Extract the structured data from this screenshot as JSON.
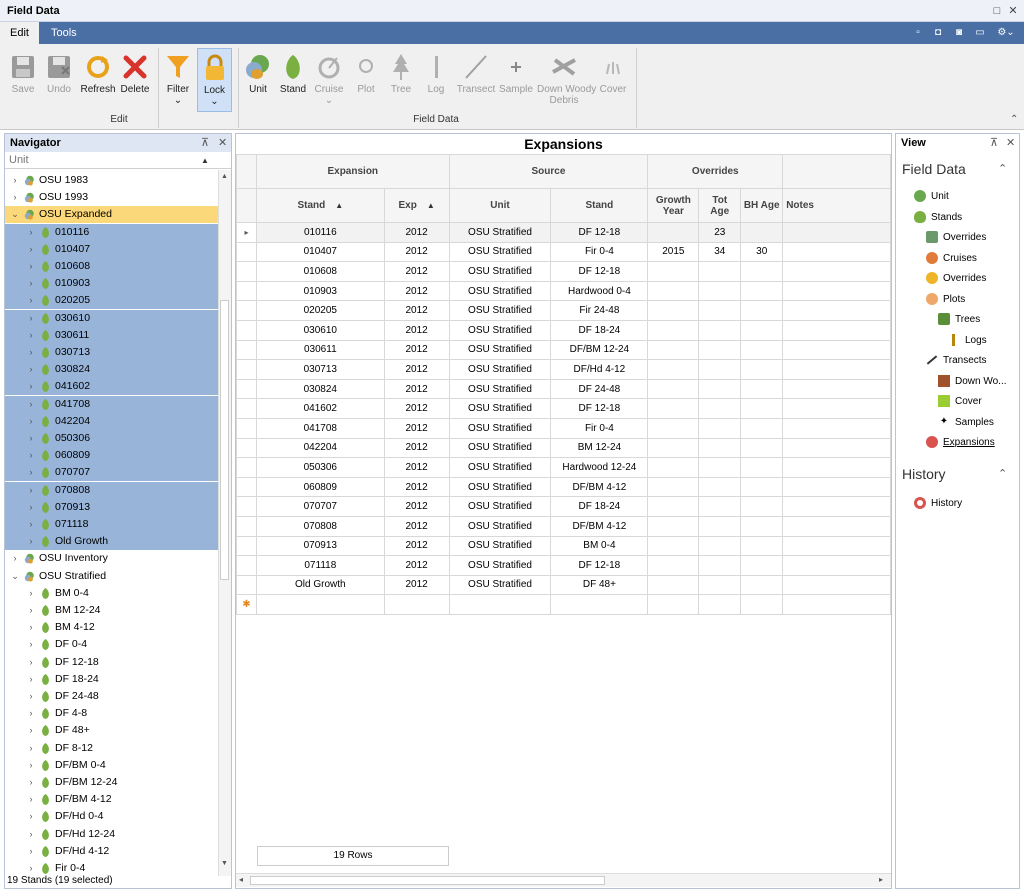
{
  "app": {
    "title": "Field Data"
  },
  "tabs": [
    "Edit",
    "Tools"
  ],
  "ribbon": {
    "edit_group": "Edit",
    "field_group": "Field Data",
    "buttons": {
      "save": "Save",
      "undo": "Undo",
      "refresh": "Refresh",
      "delete": "Delete",
      "filter": "Filter",
      "lock": "Lock",
      "unit": "Unit",
      "stand": "Stand",
      "cruise": "Cruise",
      "plot": "Plot",
      "tree": "Tree",
      "log": "Log",
      "transect": "Transect",
      "sample": "Sample",
      "down_woody_1": "Down Woody",
      "down_woody_2": "Debris",
      "cover": "Cover"
    }
  },
  "navigator": {
    "title": "Navigator",
    "column": "Unit",
    "units": [
      "OSU 1983",
      "OSU 1993",
      "OSU Expanded",
      "OSU Inventory",
      "OSU Stratified"
    ],
    "expanded_stands": [
      "010116",
      "010407",
      "010608",
      "010903",
      "020205",
      "030610",
      "030611",
      "030713",
      "030824",
      "041602",
      "041708",
      "042204",
      "050306",
      "060809",
      "070707",
      "070808",
      "070913",
      "071118",
      "Old Growth"
    ],
    "stratified_stands": [
      "BM 0-4",
      "BM 12-24",
      "BM 4-12",
      "DF 0-4",
      "DF 12-18",
      "DF 18-24",
      "DF 24-48",
      "DF 4-8",
      "DF 48+",
      "DF 8-12",
      "DF/BM 0-4",
      "DF/BM 12-24",
      "DF/BM 4-12",
      "DF/Hd 0-4",
      "DF/Hd 12-24",
      "DF/Hd 4-12",
      "Fir 0-4"
    ],
    "status": "19 Stands (19 selected)"
  },
  "grid": {
    "title": "Expansions",
    "bands": {
      "expansion": "Expansion",
      "source": "Source",
      "overrides": "Overrides"
    },
    "columns": {
      "stand": "Stand",
      "exp": "Exp",
      "unit": "Unit",
      "src_stand": "Stand",
      "growth_year_1": "Growth",
      "growth_year_2": "Year",
      "tot_age_1": "Tot",
      "tot_age_2": "Age",
      "bh_age": "BH Age",
      "notes": "Notes"
    },
    "rows": [
      [
        "010116",
        "2012",
        "OSU Stratified",
        "DF 12-18",
        "",
        "23",
        ""
      ],
      [
        "010407",
        "2012",
        "OSU Stratified",
        "Fir 0-4",
        "2015",
        "34",
        "30"
      ],
      [
        "010608",
        "2012",
        "OSU Stratified",
        "DF 12-18",
        "",
        "",
        ""
      ],
      [
        "010903",
        "2012",
        "OSU Stratified",
        "Hardwood 0-4",
        "",
        "",
        ""
      ],
      [
        "020205",
        "2012",
        "OSU Stratified",
        "Fir 24-48",
        "",
        "",
        ""
      ],
      [
        "030610",
        "2012",
        "OSU Stratified",
        "DF 18-24",
        "",
        "",
        ""
      ],
      [
        "030611",
        "2012",
        "OSU Stratified",
        "DF/BM 12-24",
        "",
        "",
        ""
      ],
      [
        "030713",
        "2012",
        "OSU Stratified",
        "DF/Hd 4-12",
        "",
        "",
        ""
      ],
      [
        "030824",
        "2012",
        "OSU Stratified",
        "DF 24-48",
        "",
        "",
        ""
      ],
      [
        "041602",
        "2012",
        "OSU Stratified",
        "DF 12-18",
        "",
        "",
        ""
      ],
      [
        "041708",
        "2012",
        "OSU Stratified",
        "Fir 0-4",
        "",
        "",
        ""
      ],
      [
        "042204",
        "2012",
        "OSU Stratified",
        "BM 12-24",
        "",
        "",
        ""
      ],
      [
        "050306",
        "2012",
        "OSU Stratified",
        "Hardwood 12-24",
        "",
        "",
        ""
      ],
      [
        "060809",
        "2012",
        "OSU Stratified",
        "DF/BM 4-12",
        "",
        "",
        ""
      ],
      [
        "070707",
        "2012",
        "OSU Stratified",
        "DF 18-24",
        "",
        "",
        ""
      ],
      [
        "070808",
        "2012",
        "OSU Stratified",
        "DF/BM 4-12",
        "",
        "",
        ""
      ],
      [
        "070913",
        "2012",
        "OSU Stratified",
        "BM 0-4",
        "",
        "",
        ""
      ],
      [
        "071118",
        "2012",
        "OSU Stratified",
        "DF 12-18",
        "",
        "",
        ""
      ],
      [
        "Old Growth",
        "2012",
        "OSU Stratified",
        "DF 48+",
        "",
        "",
        ""
      ]
    ],
    "row_count": "19 Rows"
  },
  "view": {
    "title": "View",
    "field_data_title": "Field Data",
    "items": [
      "Unit",
      "Stands",
      "Overrides",
      "Cruises",
      "Overrides",
      "Plots",
      "Trees",
      "Logs",
      "Transects",
      "Down Wo...",
      "Cover",
      "Samples",
      "Expansions"
    ],
    "history_title": "History",
    "history_item": "History"
  },
  "colors": {
    "accent": "#4a6fa5",
    "selection": "#98b4d8",
    "current": "#fbd87a"
  }
}
